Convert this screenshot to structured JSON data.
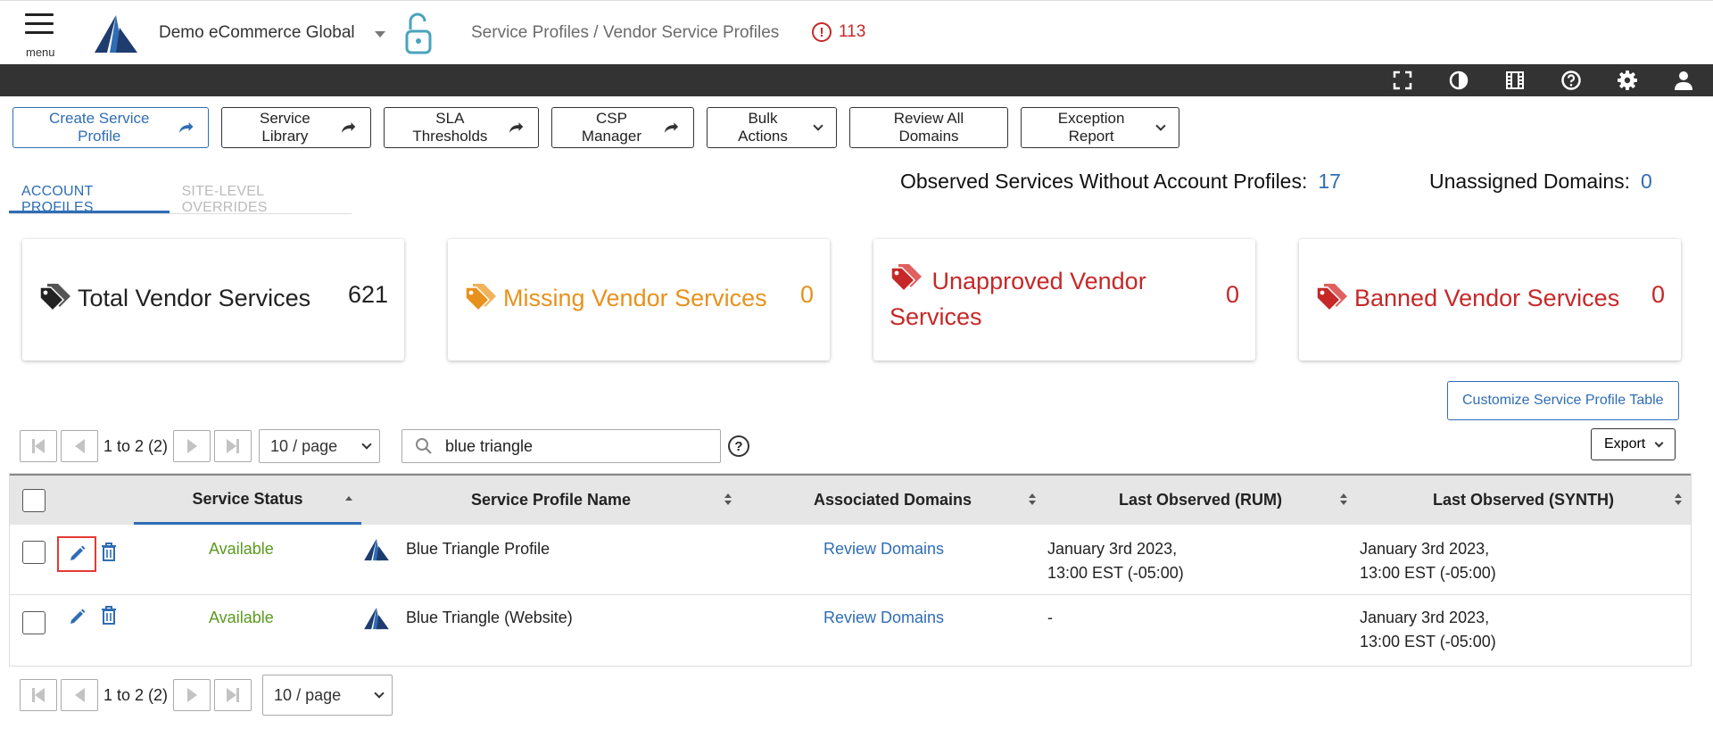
{
  "header": {
    "menu_label": "menu",
    "account_name": "Demo eCommerce Global",
    "breadcrumb": "Service Profiles / Vendor Service Profiles",
    "alert_count": "113",
    "icons": [
      "menu-icon",
      "logo",
      "unlocked-icon",
      "alert-icon"
    ]
  },
  "toolbar": {
    "icons": [
      "fullscreen-icon",
      "contrast-icon",
      "film-icon",
      "help-icon",
      "settings-icon",
      "user-icon"
    ]
  },
  "actions": {
    "create": "Create Service Profile",
    "library": "Service Library",
    "sla": "SLA Thresholds",
    "csp": "CSP Manager",
    "bulk": "Bulk Actions",
    "review_all": "Review All Domains",
    "exception": "Exception Report"
  },
  "tabs": {
    "account": "ACCOUNT PROFILES",
    "site": "SITE-LEVEL OVERRIDES"
  },
  "stats": {
    "observed_label": "Observed Services Without Account Profiles:",
    "observed_value": "17",
    "unassigned_label": "Unassigned Domains:",
    "unassigned_value": "0"
  },
  "cards": [
    {
      "title": "Total Vendor Services",
      "count": "621",
      "color": "#222222"
    },
    {
      "title": "Missing Vendor Services",
      "count": "0",
      "color": "#e8911c"
    },
    {
      "title": "Unapproved Vendor Services",
      "count": "0",
      "color": "#c62828"
    },
    {
      "title": "Banned Vendor Services",
      "count": "0",
      "color": "#c62828"
    }
  ],
  "customize_label": "Customize Service Profile Table",
  "pager": {
    "range": "1 to 2 (2)",
    "page_size": "10 / page"
  },
  "search": {
    "value": "blue triangle",
    "help": "?"
  },
  "export_label": "Export",
  "table": {
    "columns": {
      "status": "Service Status",
      "name": "Service Profile Name",
      "domains": "Associated Domains",
      "rum": "Last Observed (RUM)",
      "synth": "Last Observed (SYNTH)"
    },
    "rows": [
      {
        "status": "Available",
        "name": "Blue Triangle Profile",
        "domains": "Review Domains",
        "rum_line1": "January 3rd 2023,",
        "rum_line2": "13:00 EST (-05:00)",
        "synth_line1": "January 3rd 2023,",
        "synth_line2": "13:00 EST (-05:00)"
      },
      {
        "status": "Available",
        "name": "Blue Triangle (Website)",
        "domains": "Review Domains",
        "rum_line1": "-",
        "rum_line2": "",
        "synth_line1": "January 3rd 2023,",
        "synth_line2": "13:00 EST (-05:00)"
      }
    ]
  },
  "colors": {
    "accent": "#2f6db5",
    "available": "#5b9a1e",
    "warning": "#e8911c",
    "danger": "#c62828",
    "toolbar": "#333333",
    "highlight": "#e53935"
  }
}
